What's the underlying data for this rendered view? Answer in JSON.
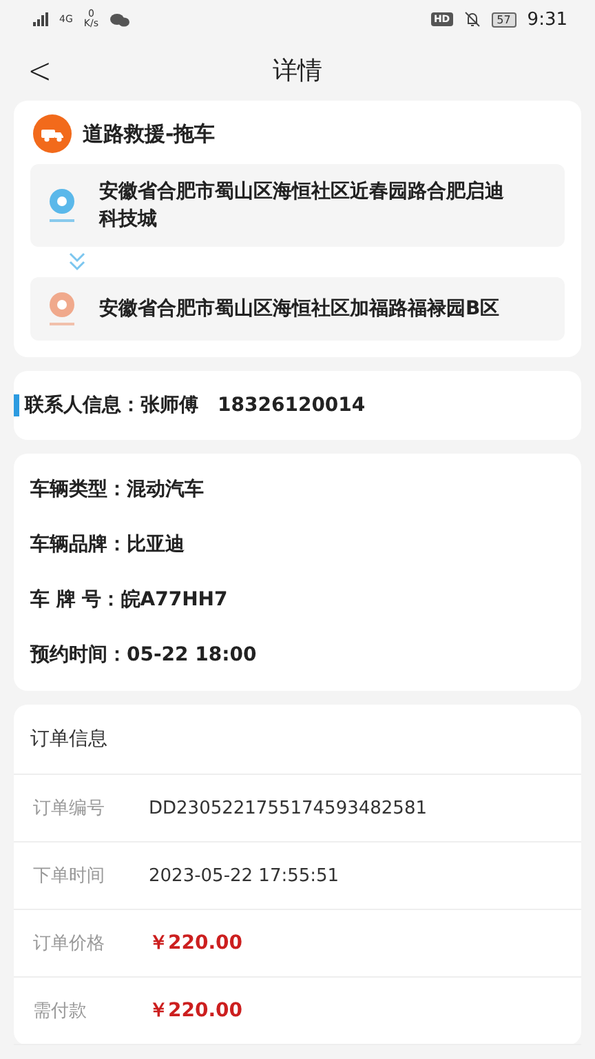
{
  "status_bar": {
    "network": "4G",
    "speed_value": "0",
    "speed_unit": "K/s",
    "hd": "HD",
    "battery": "57",
    "time": "9:31"
  },
  "header": {
    "back": "<",
    "title": "详情"
  },
  "route": {
    "service": "道路救援-拖车",
    "stops": [
      {
        "kind": "start",
        "address": "安徽省合肥市蜀山区海恒社区近春园路合肥启迪科技城"
      },
      {
        "kind": "end",
        "address": "安徽省合肥市蜀山区海恒社区加福路福禄园B区"
      }
    ]
  },
  "contact": {
    "label": "联系人信息：",
    "name": "张师傅",
    "phone": "18326120014"
  },
  "vehicle": [
    {
      "label": "车辆类型：",
      "value": "混动汽车"
    },
    {
      "label": "车辆品牌：",
      "value": "比亚迪"
    },
    {
      "label": "车 牌 号：",
      "value": "皖A77HH7"
    },
    {
      "label": "预约时间：",
      "value": "05-22 18:00"
    }
  ],
  "order": {
    "title": "订单信息",
    "rows": [
      {
        "label": "订单编号",
        "value": "DD2305221755174593482581",
        "kind": "text"
      },
      {
        "label": "下单时间",
        "value": "2023-05-22 17:55:51",
        "kind": "text"
      },
      {
        "label": "订单价格",
        "value": "￥220.00",
        "kind": "price"
      },
      {
        "label": "需付款",
        "value": "￥220.00",
        "kind": "price"
      }
    ]
  }
}
